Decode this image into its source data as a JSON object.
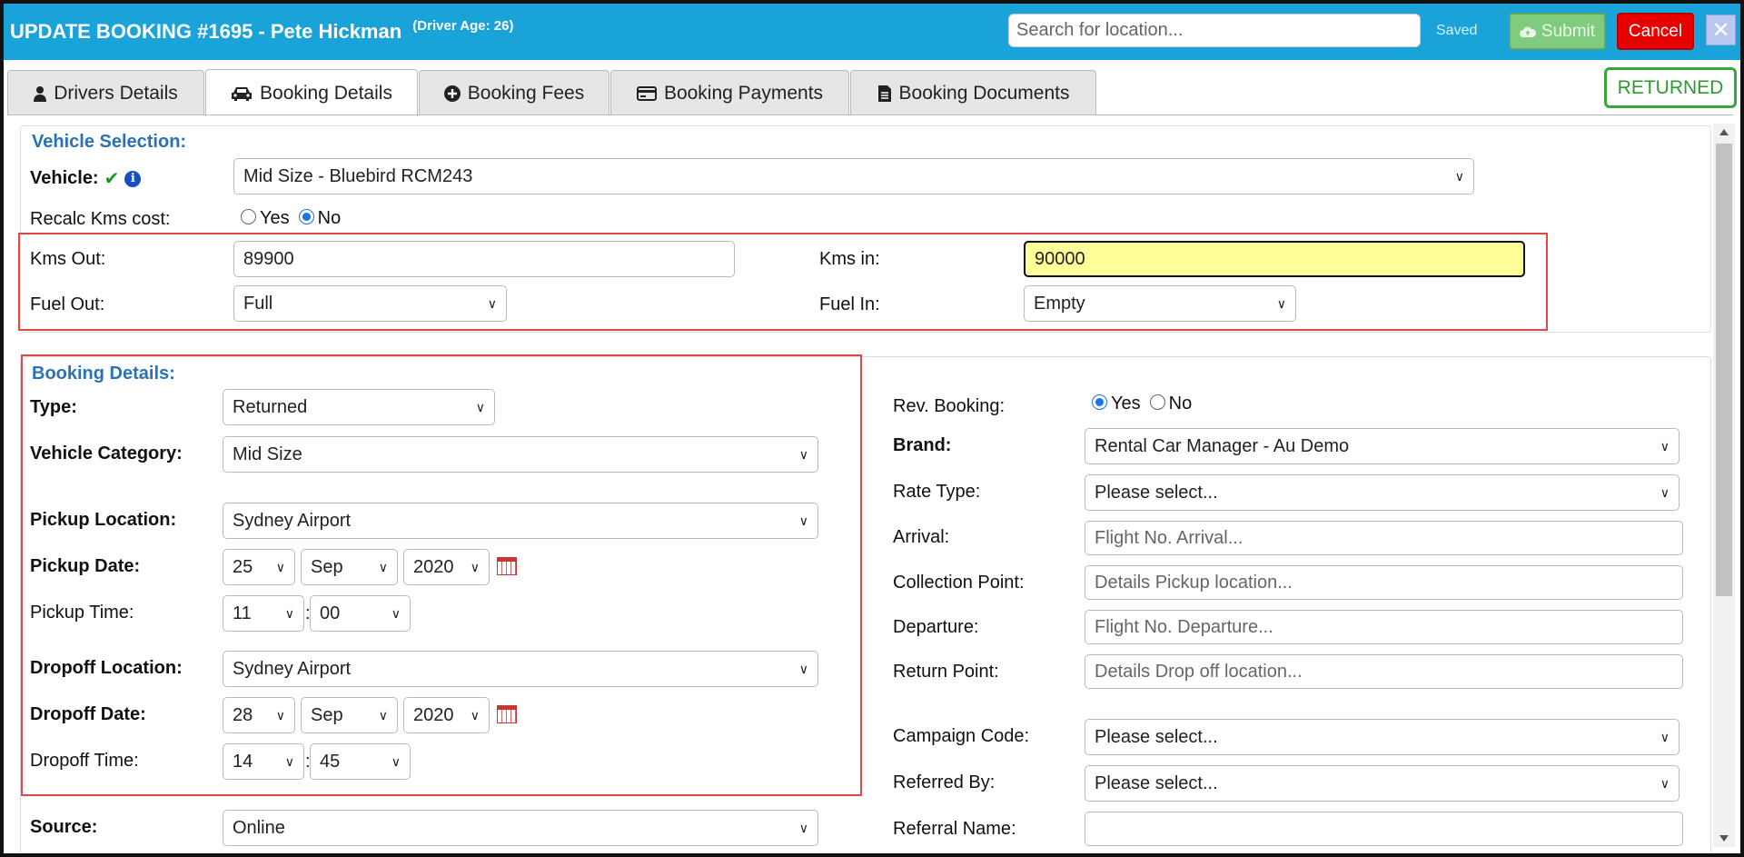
{
  "header": {
    "title": "UPDATE BOOKING #1695  - Pete Hickman",
    "driver_age": "(Driver Age: 26)",
    "search_placeholder": "Search for location...",
    "saved_label": "Saved",
    "submit_label": "Submit",
    "cancel_label": "Cancel",
    "close_label": "✕"
  },
  "tabs": [
    {
      "label": "Drivers Details",
      "icon": "user-icon"
    },
    {
      "label": "Booking Details",
      "icon": "car-icon",
      "active": true
    },
    {
      "label": "Booking Fees",
      "icon": "plus-circle-icon"
    },
    {
      "label": "Booking Payments",
      "icon": "credit-card-icon"
    },
    {
      "label": "Booking Documents",
      "icon": "document-icon"
    }
  ],
  "status_badge": "RETURNED",
  "vehicle_selection": {
    "title": "Vehicle Selection:",
    "vehicle_label": "Vehicle:",
    "vehicle_value": "Mid Size - Bluebird RCM243",
    "recalc_label": "Recalc Kms cost:",
    "recalc_yes": "Yes",
    "recalc_no": "No",
    "kms_out_label": "Kms Out:",
    "kms_out_value": "89900",
    "kms_in_label": "Kms in:",
    "kms_in_value": "90000",
    "fuel_out_label": "Fuel Out:",
    "fuel_out_value": "Full",
    "fuel_in_label": "Fuel In:",
    "fuel_in_value": "Empty"
  },
  "booking_details": {
    "title": "Booking Details:",
    "type_label": "Type:",
    "type_value": "Returned",
    "vehicle_category_label": "Vehicle Category:",
    "vehicle_category_value": "Mid Size",
    "pickup_location_label": "Pickup Location:",
    "pickup_location_value": "Sydney Airport",
    "pickup_date_label": "Pickup Date:",
    "pickup_day": "25",
    "pickup_month": "Sep",
    "pickup_year": "2020",
    "pickup_time_label": "Pickup Time:",
    "pickup_hour": "11",
    "pickup_minute": "00",
    "dropoff_location_label": "Dropoff Location:",
    "dropoff_location_value": "Sydney Airport",
    "dropoff_date_label": "Dropoff Date:",
    "dropoff_day": "28",
    "dropoff_month": "Sep",
    "dropoff_year": "2020",
    "dropoff_time_label": "Dropoff Time:",
    "dropoff_hour": "14",
    "dropoff_minute": "45",
    "source_label": "Source:",
    "source_value": "Online",
    "time_separator": ":"
  },
  "right_panel": {
    "rev_booking_label": "Rev. Booking:",
    "rev_yes": "Yes",
    "rev_no": "No",
    "brand_label": "Brand:",
    "brand_value": "Rental Car Manager - Au Demo",
    "rate_type_label": "Rate Type:",
    "rate_type_value": "Please select...",
    "arrival_label": "Arrival:",
    "arrival_placeholder": "Flight No. Arrival...",
    "collection_label": "Collection Point:",
    "collection_placeholder": "Details Pickup location...",
    "departure_label": "Departure:",
    "departure_placeholder": "Flight No. Departure...",
    "return_label": "Return Point:",
    "return_placeholder": "Details Drop off location...",
    "campaign_label": "Campaign Code:",
    "campaign_value": "Please select...",
    "referred_by_label": "Referred By:",
    "referred_by_value": "Please select...",
    "referral_name_label": "Referral Name:",
    "referral_name_value": ""
  },
  "colors": {
    "header_bg": "#1aa3d9",
    "section_title": "#2a72b5",
    "highlight_box": "#e04848",
    "returned_badge": "#3aa63a"
  }
}
